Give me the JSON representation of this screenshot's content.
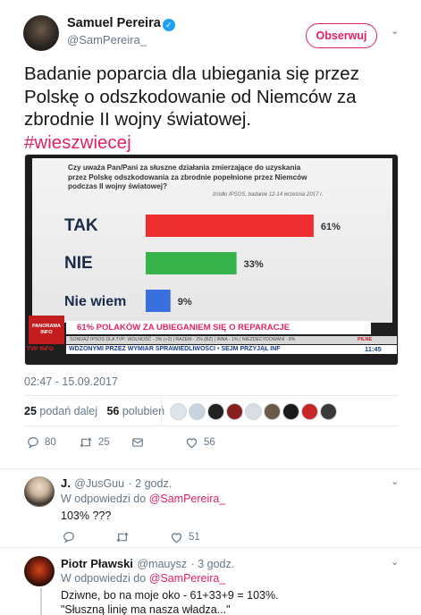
{
  "tweet": {
    "author_name": "Samuel Pereira",
    "author_handle": "@SamPereira_",
    "follow_label": "Obserwuj",
    "text": "Badanie poparcia dla ubiegania się przez Polskę o odszkodowanie od Niemców za zbrodnie II wojny światowej.",
    "text_lines": [
      "Badanie poparcia dla ubiegania się przez",
      "Polskę o odszkodowanie od Niemców za",
      "zbrodnie II wojny światowej."
    ],
    "hashtag": "#wieszwiecej",
    "timestamp": "02:47 - 15.09.2017",
    "retweets_count": "25",
    "retweets_label": "podań dalej",
    "likes_count": "56",
    "likes_label": "polubień",
    "actions": {
      "reply_count": "80",
      "retweet_count": "25",
      "like_count": "56"
    }
  },
  "media": {
    "question_lines": [
      "Czy uważa Pan/Pani za słuszne działania zmierzające do uzyskania",
      "przez Polskę odszkodowania za zbrodnie popełnione przez Niemców",
      "podczas II wojny światowej?"
    ],
    "source": "źródło IPSOS, badanie 12-14 września 2017 r.",
    "chart_data": {
      "type": "bar",
      "orientation": "horizontal",
      "categories": [
        "TAK",
        "NIE",
        "Nie wiem"
      ],
      "values": [
        61,
        33,
        9
      ],
      "value_labels": [
        "61%",
        "33%",
        "9%"
      ],
      "colors": [
        "#ee2e2e",
        "#36b34a",
        "#3a6fe0"
      ]
    },
    "logo_text": "PANORAMA INFO",
    "banner_text": "61% POLAKÓW ZA UBIEGANIEM SIĘ O REPARACJE",
    "ticker_line1": "SONDAŻ IPSOS DLA TVP: WOLNOŚĆ - 3% (+2) | RAZEM - 2% (BZ) | INNA - 1% | NIEZDECYDOWANI - 8%",
    "ticker_tag": "PILNE",
    "ticker_line2": "WDZONYMI PRZEZ WYMIAR SPRAWIEDLIWOŚCI • SEJM PRZYJĄŁ INF",
    "clock": "11:45",
    "channel": "TVP INFO"
  },
  "replies": [
    {
      "name": "J.",
      "handle": "@JusGuu",
      "time": "· 2 godz.",
      "in_reply_prefix": "W odpowiedzi do",
      "in_reply_handle": "@SamPereira_",
      "text_lines": [
        "103% ???"
      ],
      "like_count": "51"
    },
    {
      "name": "Piotr Pławski",
      "handle": "@mauysz",
      "time": "· 3 godz.",
      "in_reply_prefix": "W odpowiedzi do",
      "in_reply_handle": "@SamPereira_",
      "text_lines": [
        "Dziwne, bo na moje oko - 61+33+9 = 103%.",
        "\"Słuszną linię ma nasza władza...\""
      ]
    }
  ]
}
